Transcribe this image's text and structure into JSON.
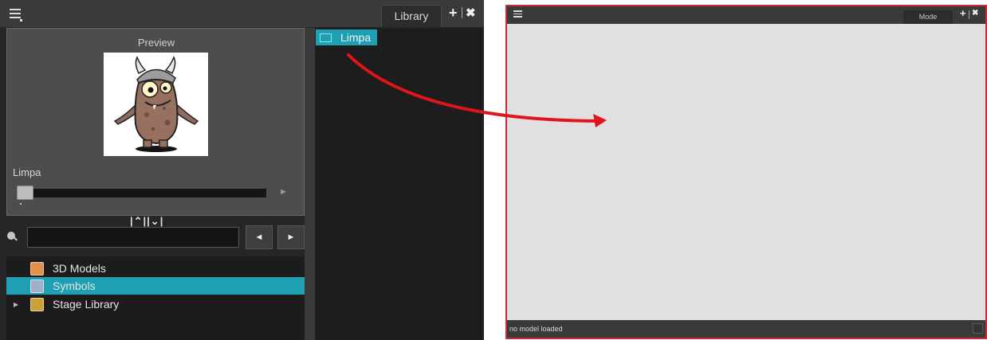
{
  "library_window": {
    "tab_label": "Library",
    "add_symbol": "+",
    "close_symbol": "✖",
    "preview": {
      "title": "Preview",
      "asset_name": "Limpa",
      "play_symbol": "►"
    },
    "collapse_controls": "|⌃||⌄|",
    "search": {
      "value": "",
      "prev_symbol": "◄",
      "next_symbol": "►"
    },
    "tree": {
      "items": [
        {
          "label": "3D Models",
          "icon": "3d-models-icon",
          "icon_color": "#e3904b"
        },
        {
          "label": "Symbols",
          "icon": "symbols-icon",
          "icon_color": "#9fb0c8",
          "selected": true
        },
        {
          "label": "Stage Library",
          "icon": "stage-library-icon",
          "icon_color": "#c9a13b",
          "expander": "▸"
        }
      ]
    },
    "content": {
      "items": [
        {
          "label": "Limpa",
          "icon": "folder-icon",
          "selected": true
        }
      ]
    }
  },
  "model_window": {
    "tab_label": "Mode",
    "add_symbol": "+",
    "close_symbol": "✖",
    "status_text": "no model loaded"
  },
  "annotation": {
    "arrow_color": "#e0141b"
  },
  "colors": {
    "selection": "#1e9fb2",
    "model_highlight_border": "#c42d33"
  }
}
